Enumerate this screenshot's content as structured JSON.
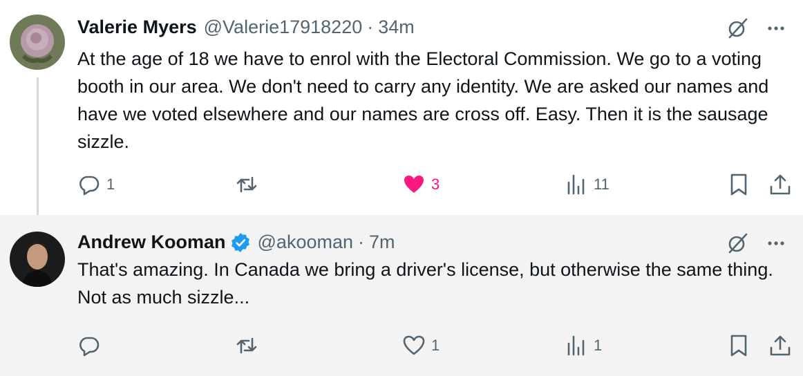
{
  "tweets": [
    {
      "author_name": "Valerie Myers",
      "handle": "@Valerie17918220",
      "separator": "·",
      "time": "34m",
      "text": "At the age of 18 we have to enrol with the Electoral Commission. We go to a voting booth in our area. We don't need to carry any identity. We are asked our names and have we voted elsewhere and our names are cross off. Easy. Then it is  the sausage sizzle.",
      "replies": "1",
      "retweets": "",
      "likes": "3",
      "views": "11",
      "liked": true,
      "verified": false
    },
    {
      "author_name": "Andrew Kooman",
      "handle": "@akooman",
      "separator": "·",
      "time": "7m",
      "text": "That's amazing. In Canada we bring a driver's license, but otherwise the same thing. Not as much sizzle...",
      "replies": "",
      "retweets": "",
      "likes": "1",
      "views": "1",
      "liked": false,
      "verified": true
    }
  ],
  "colors": {
    "like_active": "#f91880",
    "verified_blue": "#1d9bf0",
    "muted": "#536471",
    "text": "#0f1419",
    "thread_line": "#cfd9de"
  },
  "icons": [
    "grok-icon",
    "more-icon",
    "reply-icon",
    "retweet-icon",
    "like-icon",
    "views-icon",
    "bookmark-icon",
    "share-icon",
    "verified-badge-icon"
  ]
}
